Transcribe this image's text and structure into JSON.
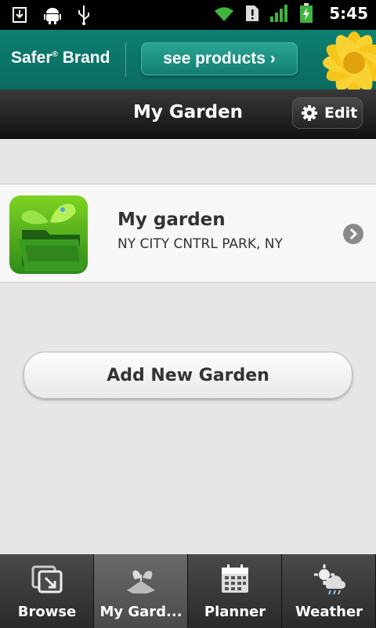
{
  "status_bar": {
    "icons": [
      "download-icon",
      "android-icon",
      "usb-icon",
      "wifi-icon",
      "sim-alert-icon",
      "signal-icon",
      "battery-charging-icon"
    ],
    "time": "5:45"
  },
  "banner": {
    "brand": "Safer",
    "brand_mark": "®",
    "brand_suffix": " Brand",
    "button_label": "see products",
    "button_chevron": "›",
    "colors": {
      "background": "#0e7f72",
      "flower": "#f6c519"
    }
  },
  "header": {
    "title": "My Garden",
    "edit_label": "Edit"
  },
  "gardens": [
    {
      "name": "My garden",
      "location": "NY CITY CNTRL PARK, NY"
    }
  ],
  "add_button_label": "Add New Garden",
  "tabs": [
    {
      "label": "Browse",
      "icon": "browse-icon",
      "active": false
    },
    {
      "label": "My Gard...",
      "icon": "my-garden-icon",
      "active": true
    },
    {
      "label": "Planner",
      "icon": "calendar-icon",
      "active": false
    },
    {
      "label": "Weather",
      "icon": "weather-icon",
      "active": false
    }
  ]
}
